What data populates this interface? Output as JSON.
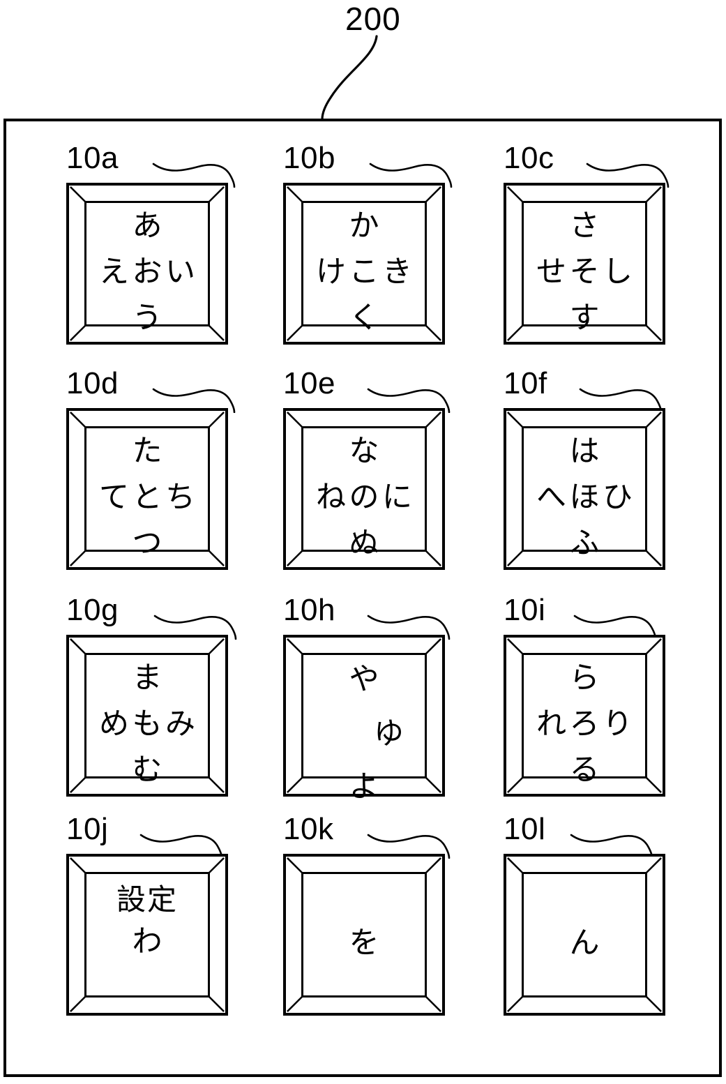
{
  "figure": {
    "device_ref": "200",
    "caption_font_px": 46
  },
  "keypad": {
    "rows": [
      [
        {
          "ref": "10a",
          "type": "hiragana",
          "glyphs": {
            "top": "あ",
            "mid_left": "え",
            "mid_center": "お",
            "mid_right": "い",
            "bottom": "う"
          }
        },
        {
          "ref": "10b",
          "type": "hiragana",
          "glyphs": {
            "top": "か",
            "mid_left": "け",
            "mid_center": "こ",
            "mid_right": "き",
            "bottom": "く"
          }
        },
        {
          "ref": "10c",
          "type": "hiragana",
          "glyphs": {
            "top": "さ",
            "mid_left": "せ",
            "mid_center": "そ",
            "mid_right": "し",
            "bottom": "す"
          }
        }
      ],
      [
        {
          "ref": "10d",
          "type": "hiragana",
          "glyphs": {
            "top": "た",
            "mid_left": "て",
            "mid_center": "と",
            "mid_right": "ち",
            "bottom": "つ"
          }
        },
        {
          "ref": "10e",
          "type": "hiragana",
          "glyphs": {
            "top": "な",
            "mid_left": "ね",
            "mid_center": "の",
            "mid_right": "に",
            "bottom": "ぬ"
          }
        },
        {
          "ref": "10f",
          "type": "hiragana",
          "glyphs": {
            "top": "は",
            "mid_left": "へ",
            "mid_center": "ほ",
            "mid_right": "ひ",
            "bottom": "ふ"
          }
        }
      ],
      [
        {
          "ref": "10g",
          "type": "hiragana",
          "glyphs": {
            "top": "ま",
            "mid_left": "め",
            "mid_center": "も",
            "mid_right": "み",
            "bottom": "む"
          }
        },
        {
          "ref": "10h",
          "type": "hiragana-ya",
          "glyphs": {
            "top": "や",
            "mid_right": "ゆ",
            "bottom": "よ"
          }
        },
        {
          "ref": "10i",
          "type": "hiragana",
          "glyphs": {
            "top": "ら",
            "mid_left": "れ",
            "mid_center": "ろ",
            "mid_right": "り",
            "bottom": "る"
          }
        }
      ],
      [
        {
          "ref": "10j",
          "type": "function-kana",
          "glyphs": {
            "top": "設定",
            "under": "わ"
          }
        },
        {
          "ref": "10k",
          "type": "single",
          "glyphs": {
            "center": "を"
          }
        },
        {
          "ref": "10l",
          "type": "single",
          "glyphs": {
            "center": "ん"
          }
        }
      ]
    ]
  }
}
